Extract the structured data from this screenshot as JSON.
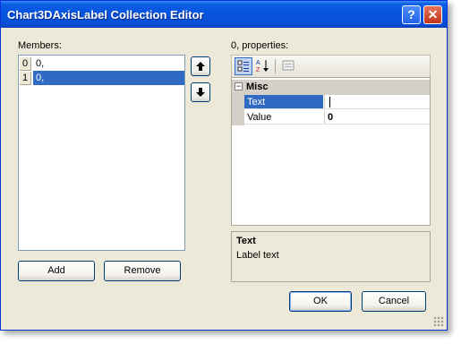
{
  "window": {
    "title": "Chart3DAxisLabel Collection Editor",
    "help_glyph": "?",
    "close_glyph": "✕"
  },
  "members": {
    "label": "Members:",
    "items": [
      {
        "index": "0",
        "text": "0,"
      },
      {
        "index": "1",
        "text": "0,"
      }
    ],
    "selected_index": 1,
    "move_up_icon": "arrow-up-icon",
    "move_down_icon": "arrow-down-icon",
    "add_label": "Add",
    "remove_label": "Remove"
  },
  "properties": {
    "label": "0, properties:",
    "toolbar_icons": [
      "categorized-icon",
      "alphabetical-icon",
      "property-pages-icon"
    ],
    "category": "Misc",
    "category_toggle": "−",
    "rows": [
      {
        "name": "Text",
        "value": ""
      },
      {
        "name": "Value",
        "value": "0"
      }
    ],
    "description_title": "Text",
    "description_text": "Label text"
  },
  "footer": {
    "ok_label": "OK",
    "cancel_label": "Cancel"
  },
  "colors": {
    "titlebar": "#0553dd",
    "selection": "#316ac5",
    "dialog_bg": "#ece9d8"
  }
}
